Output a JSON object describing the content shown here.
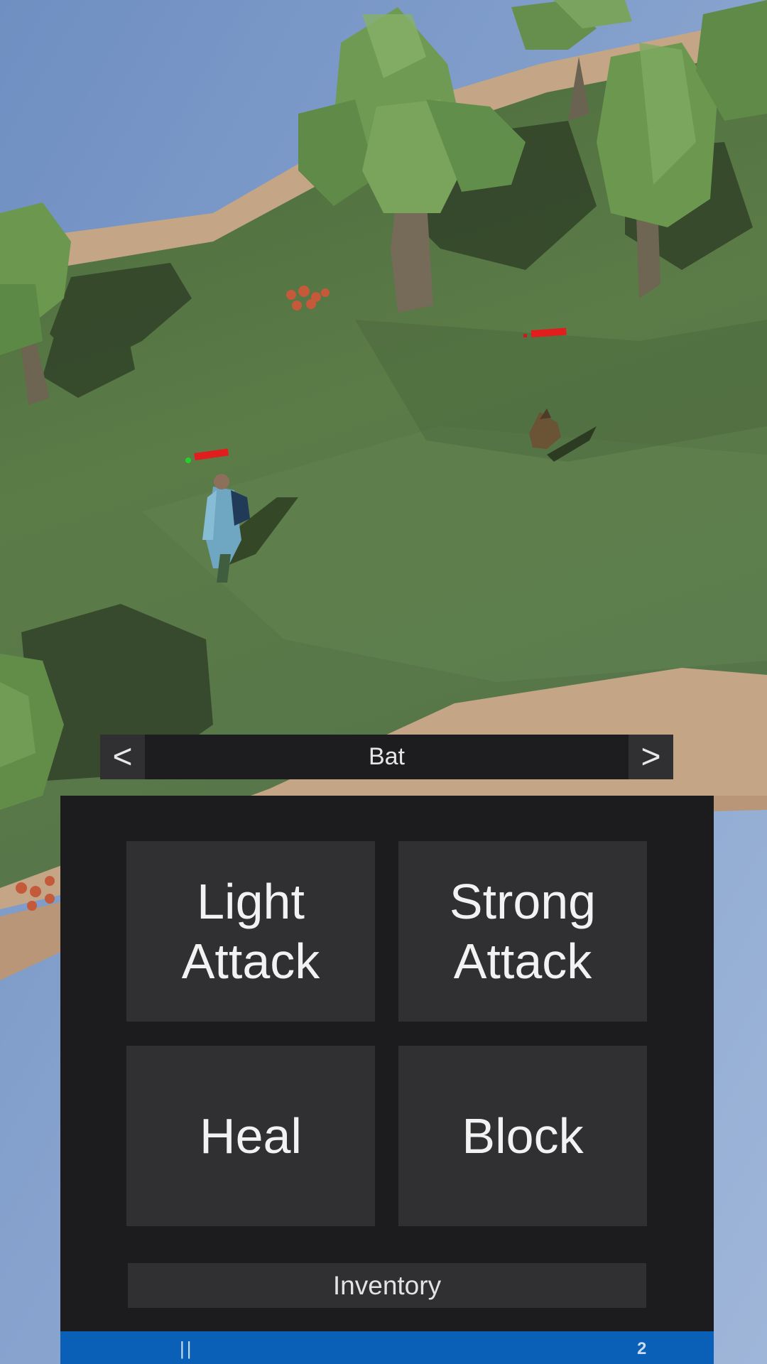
{
  "game": {
    "target_selector": {
      "prev_label": "<",
      "target_name": "Bat",
      "next_label": ">"
    },
    "actions": [
      {
        "label": "Light\nAttack"
      },
      {
        "label": "Strong\nAttack"
      },
      {
        "label": "Heal"
      },
      {
        "label": "Block"
      }
    ],
    "inventory_label": "Inventory",
    "status_bar": {
      "pause_label": "||",
      "count": "2"
    },
    "player": {
      "health_fraction": 0.92
    },
    "enemy": {
      "health_fraction": 0.9
    }
  },
  "colors": {
    "grass": "#5a7a46",
    "sand": "#c9a985",
    "water": "#7493c4",
    "tree": "#6e9a55",
    "health": "#e11d1d",
    "panel": "#1c1c1e",
    "button": "#303033",
    "accent": "#0a5fb6"
  }
}
